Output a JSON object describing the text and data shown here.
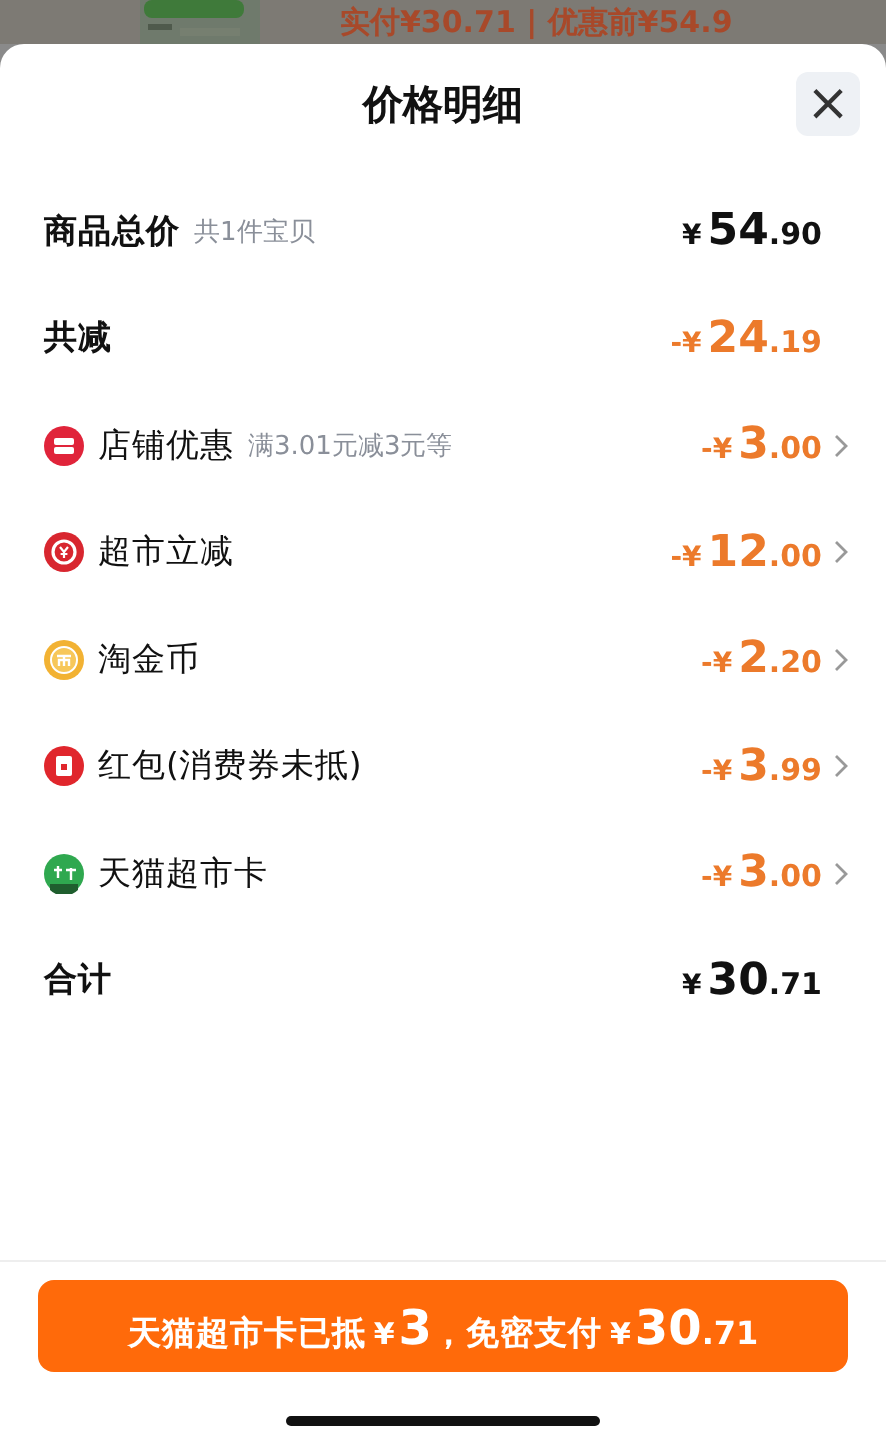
{
  "background": {
    "summary": "实付¥30.71 | 优惠前¥54.9"
  },
  "sheet": {
    "title": "价格明细",
    "close": "×"
  },
  "rows": [
    {
      "kind": "sum",
      "label": "商品总价",
      "note": "共1件宝贝",
      "amount": {
        "prefix": "¥",
        "integer": "54",
        "decimal": ".90"
      }
    },
    {
      "kind": "discount",
      "label": "共减",
      "amount": {
        "prefix": "-¥",
        "integer": "24",
        "decimal": ".19"
      }
    },
    {
      "kind": "item",
      "label": "店铺优惠",
      "note": "满3.01元减3元等",
      "amount": {
        "prefix": "-¥",
        "integer": "3",
        "decimal": ".00"
      }
    },
    {
      "kind": "item",
      "label": "超市立减",
      "amount": {
        "prefix": "-¥",
        "integer": "12",
        "decimal": ".00"
      }
    },
    {
      "kind": "item",
      "label": "淘金币",
      "amount": {
        "prefix": "-¥",
        "integer": "2",
        "decimal": ".20"
      }
    },
    {
      "kind": "item",
      "label": "红包(消费券未抵)",
      "amount": {
        "prefix": "-¥",
        "integer": "3",
        "decimal": ".99"
      }
    },
    {
      "kind": "item",
      "label": "天猫超市卡",
      "amount": {
        "prefix": "-¥",
        "integer": "3",
        "decimal": ".00"
      }
    },
    {
      "kind": "sum",
      "label": "合计",
      "amount": {
        "prefix": "¥",
        "integer": "30",
        "decimal": ".71"
      }
    }
  ],
  "pay_button": [
    {
      "kind": "label",
      "text": "天猫超市卡已抵"
    },
    {
      "kind": "currency",
      "text": "¥"
    },
    {
      "kind": "integer",
      "text": "3"
    },
    {
      "kind": "label",
      "text": "，免密支付"
    },
    {
      "kind": "currency",
      "text": "¥"
    },
    {
      "kind": "integer",
      "text": "30"
    },
    {
      "kind": "decimal",
      "text": ".71"
    }
  ]
}
